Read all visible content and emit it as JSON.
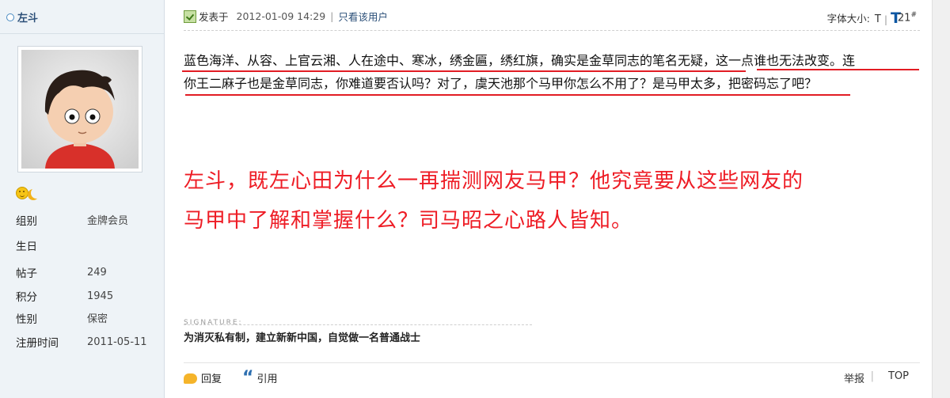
{
  "sidebar": {
    "username": "左斗",
    "profile": [
      {
        "key": "组别",
        "value": "金牌会员"
      },
      {
        "key": "生日",
        "value": ""
      },
      {
        "key": "帖子",
        "value": "249"
      },
      {
        "key": "积分",
        "value": "1945"
      },
      {
        "key": "性别",
        "value": "保密"
      },
      {
        "key": "注册时间",
        "value": "2011-05-11"
      }
    ]
  },
  "post": {
    "posted_label": "发表于",
    "time": "2012-01-09 14:29",
    "separator": "|",
    "only_author": "只看该用户",
    "font_size_label": "字体大小:",
    "font_small": "T",
    "font_large": "T",
    "floor": "21",
    "floor_mark": "#",
    "body_line1": "蓝色海洋、从容、上官云湘、人在途中、寒冰，绣金匾，绣红旗，确实是金草同志的笔名无疑，这一点谁也无法改变。连",
    "body_line2": "你王二麻子也是金草同志，你难道要否认吗？对了，虞天池那个马甲你怎么不用了？是马甲太多，把密码忘了吧？",
    "comment_line1": "左斗，既左心田为什么一再揣测网友马甲？他究竟要从这些网友的",
    "comment_line2": "马甲中了解和掌握什么？司马昭之心路人皆知。",
    "signature_label": "SIGNATURE:",
    "signature_text": "为消灭私有制，建立新新中国，自觉做一名普通战士",
    "reply_label": "回复",
    "quote_label": "引用",
    "report_label": "举报",
    "foot_separator": "|",
    "top_label": "TOP"
  },
  "colors": {
    "annotation_red": "#ee1c25",
    "underline_red": "#e21c24",
    "link_blue": "#2b4f78",
    "sidebar_bg": "#eef3f7"
  },
  "icons": [
    "online-status-icon",
    "avatar",
    "sun-rank-icon",
    "moon-rank-icon",
    "post-icon",
    "reply-icon",
    "quote-icon"
  ]
}
